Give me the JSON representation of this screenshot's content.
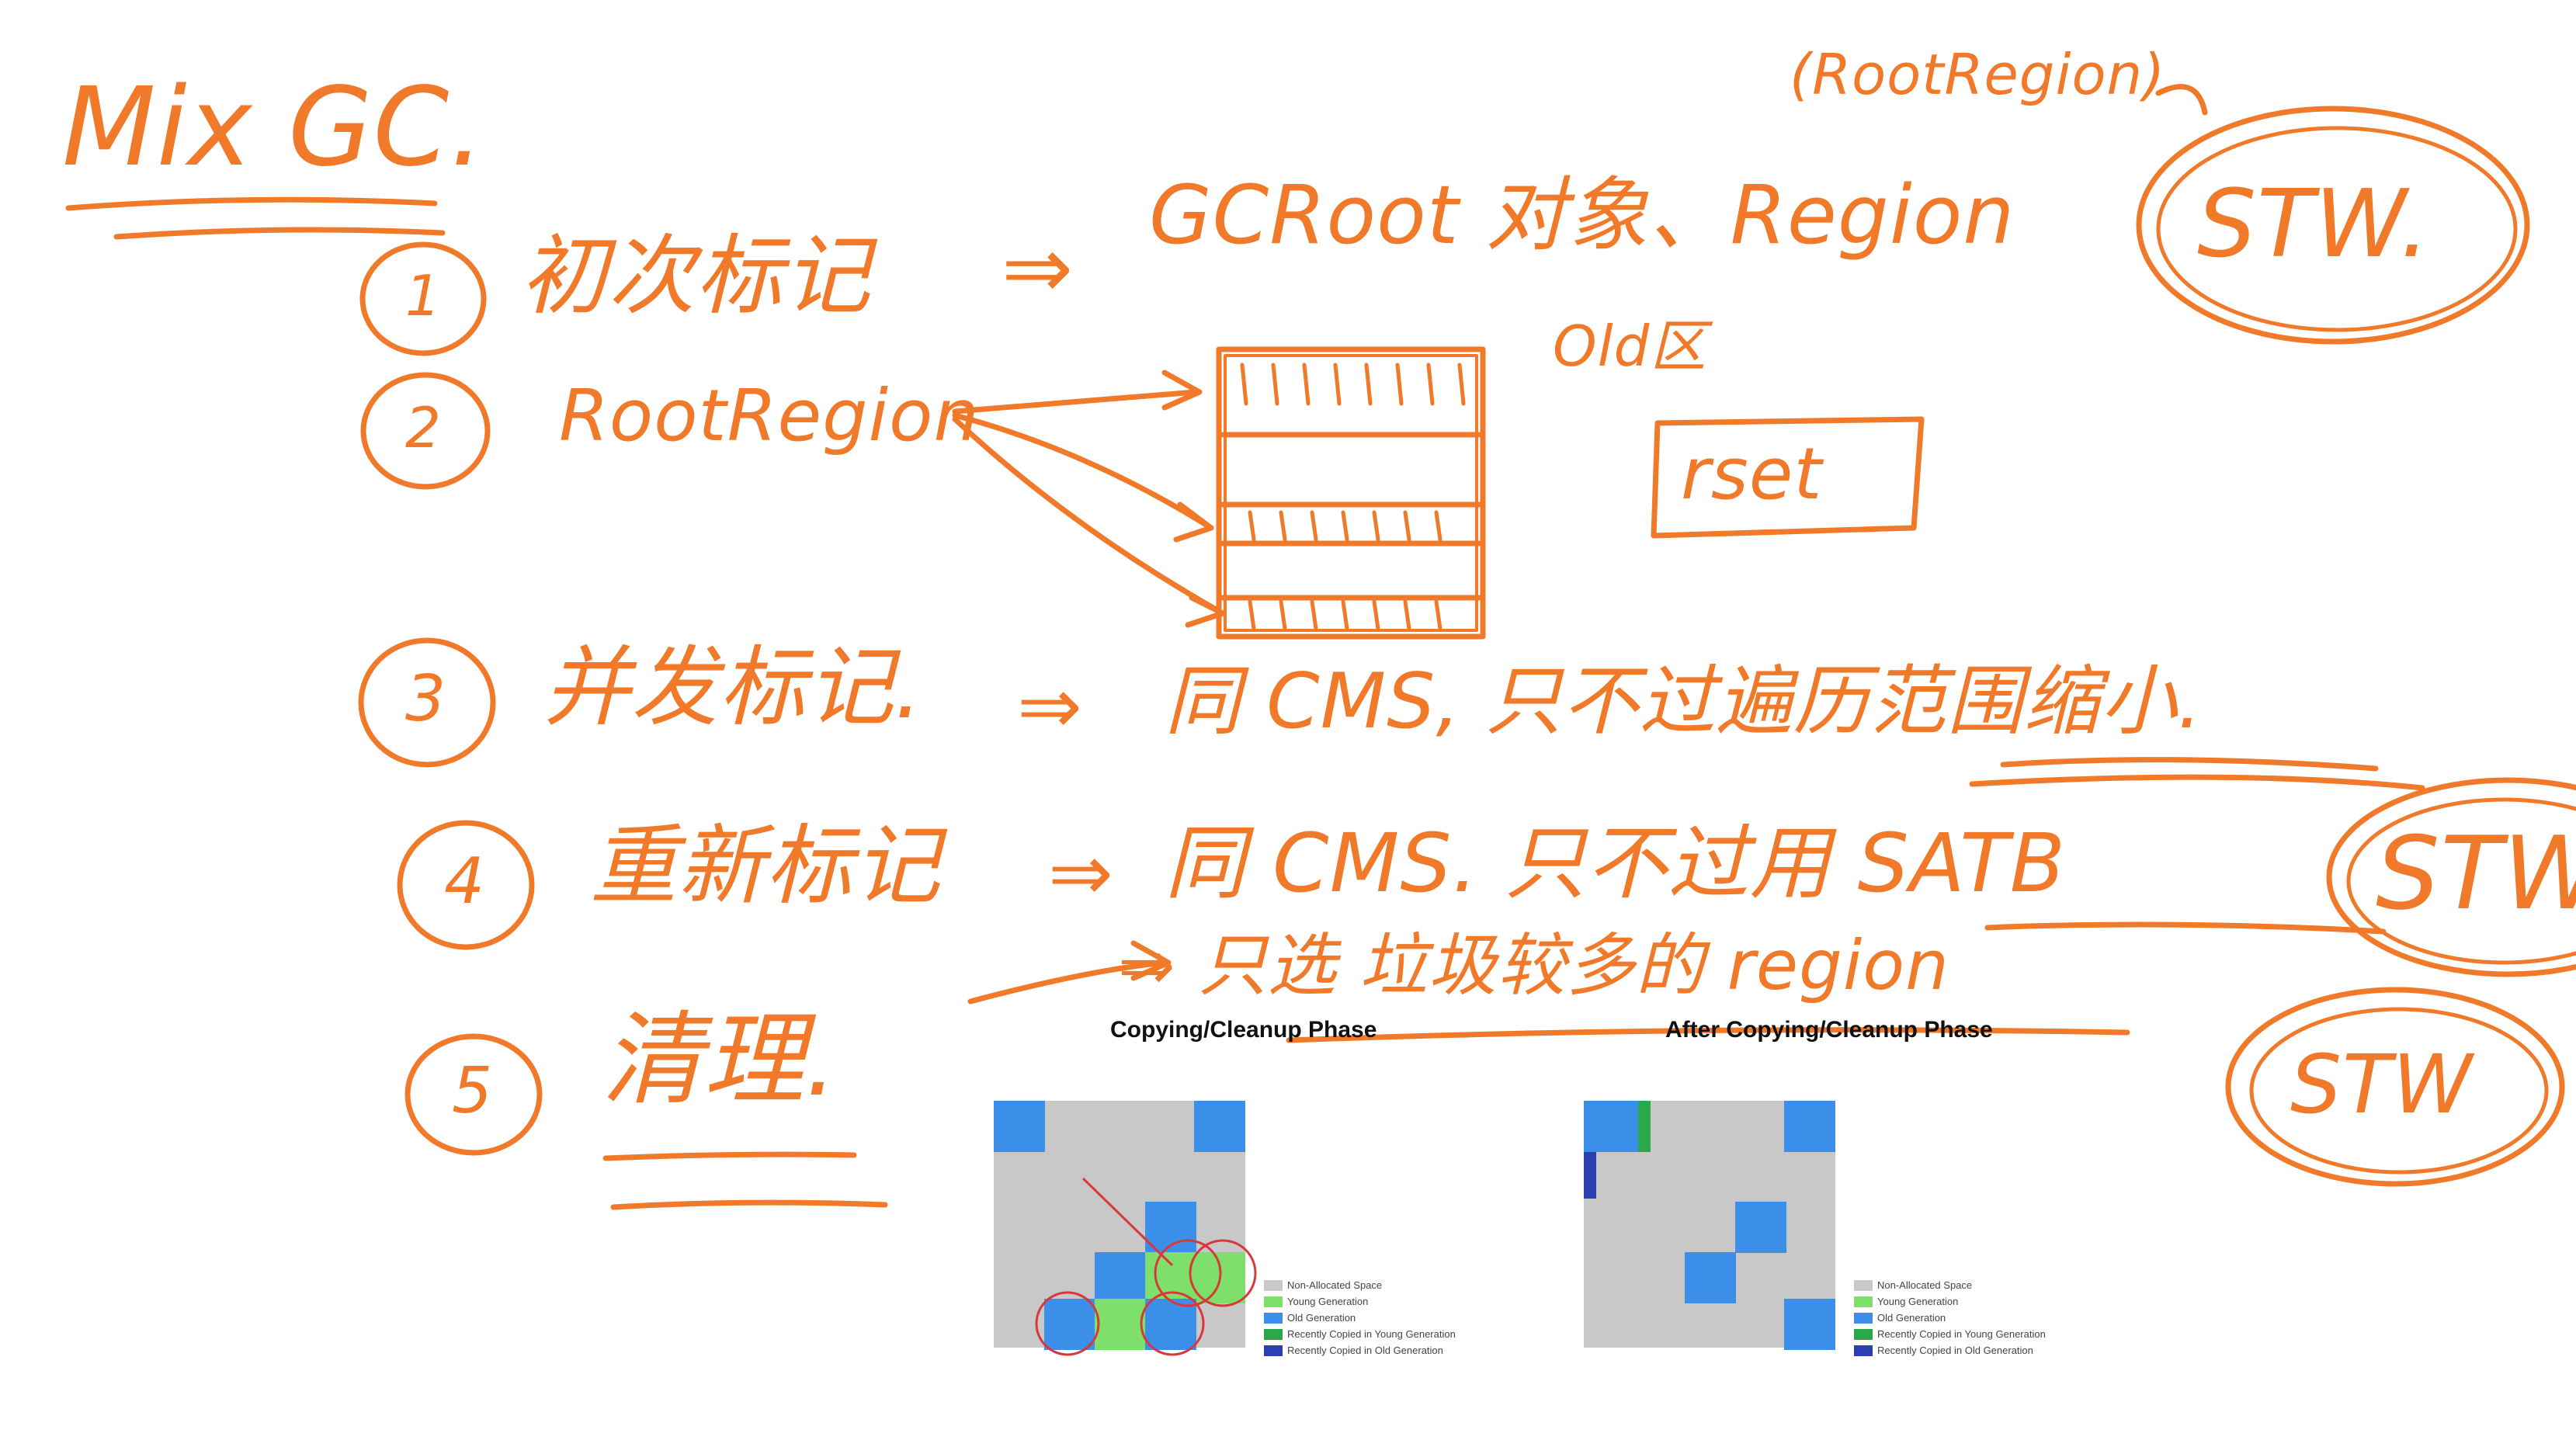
{
  "notes": {
    "title": "Mix GC.",
    "root_region_note": "(RootRegion)",
    "step1": {
      "num": "1",
      "label": "初次标记",
      "arrow": "⇒",
      "desc": "GCRoot 对象、Region"
    },
    "old_label": "Old区",
    "step2": {
      "num": "2",
      "label": "RootRegion"
    },
    "rset_label": "rset",
    "step3": {
      "num": "3",
      "label": "并发标记.",
      "arrow": "⇒",
      "desc": "同 CMS, 只不过遍历范围缩小."
    },
    "step4": {
      "num": "4",
      "label": "重新标记",
      "arrow": "⇒",
      "desc": "同 CMS. 只不过用 SATB"
    },
    "step5_note": "⇒ 只选 垃圾较多的 region",
    "step5": {
      "num": "5",
      "label": "清理."
    },
    "stw_1": "STW.",
    "stw_2": "STW",
    "stw_3": "STW"
  },
  "figure": {
    "left_title": "Copying/Cleanup Phase",
    "right_title": "After Copying/Cleanup Phase",
    "legend": [
      {
        "label": "Non-Allocated Space",
        "color": "#c8c8c8"
      },
      {
        "label": "Young Generation",
        "color": "#7ee06a"
      },
      {
        "label": "Old Generation",
        "color": "#3b8fe8"
      },
      {
        "label": "Recently Copied in Young Generation",
        "color": "#2aa84a"
      },
      {
        "label": "Recently Copied in Old Generation",
        "color": "#2a3fb0"
      }
    ]
  },
  "colors": {
    "ink": "#f07a2a",
    "highlight_circle": "#d9383a"
  }
}
